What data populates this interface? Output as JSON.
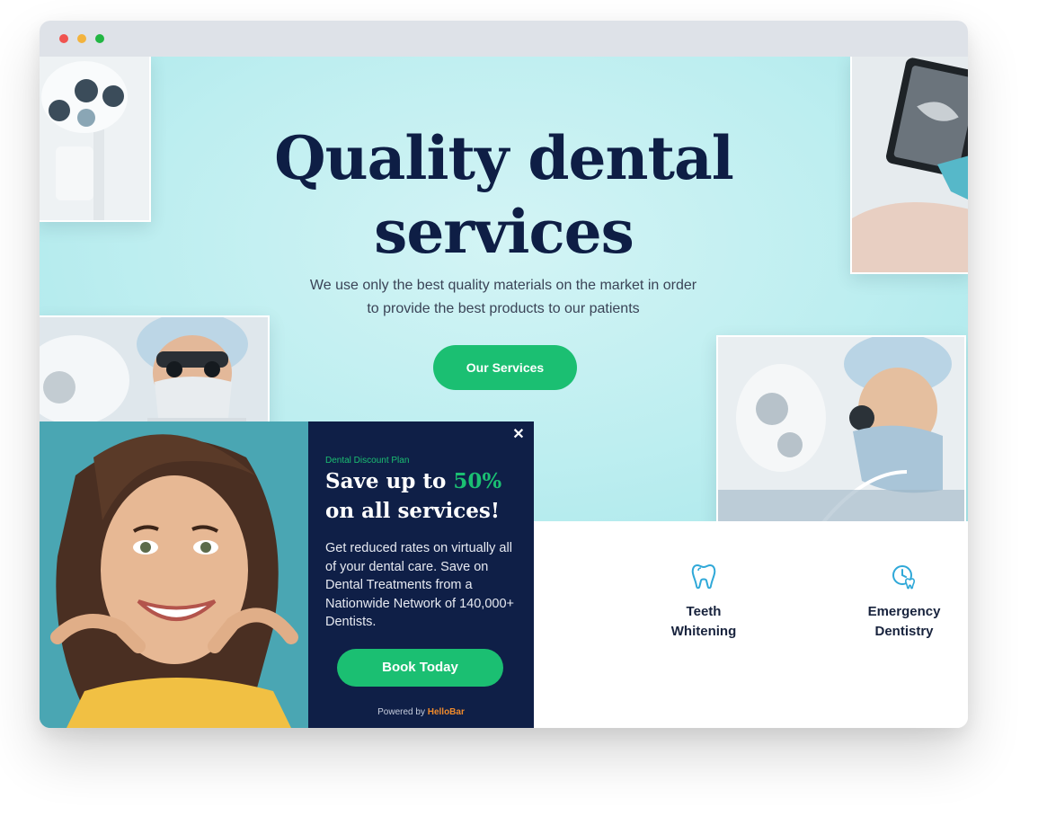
{
  "browser": {
    "controls": [
      "close",
      "minimize",
      "maximize"
    ]
  },
  "hero": {
    "title_line1": "Quality dental",
    "title_line2": "services",
    "subtitle_line1": "We use only the best quality materials on the market in order",
    "subtitle_line2": "to provide the best products to our patients",
    "button_label": "Our Services"
  },
  "services": [
    {
      "icon": "tooth-icon",
      "label_line1": "Teeth",
      "label_line2": "Whitening"
    },
    {
      "icon": "clock-tooth-icon",
      "label_line1": "Emergency",
      "label_line2": "Dentistry"
    }
  ],
  "popup": {
    "close_icon": "close-icon",
    "eyebrow": "Dental Discount Plan",
    "heading_line1_prefix": "Save up to ",
    "heading_highlight": "50%",
    "heading_line2": "on all services!",
    "body": "Get reduced rates on virtually all of your dental care. Save on Dental Treatments from a Nationwide Network of 140,000+ Dentists.",
    "button_label": "Book Today",
    "powered_prefix": "Powered by ",
    "powered_brand": "HelloBar"
  },
  "colors": {
    "navy": "#0f1f47",
    "green": "#1bbf72",
    "hero_bg": "#c4f0f2",
    "accent_blue": "#2fa8d8",
    "brand_orange": "#f08a2c"
  }
}
